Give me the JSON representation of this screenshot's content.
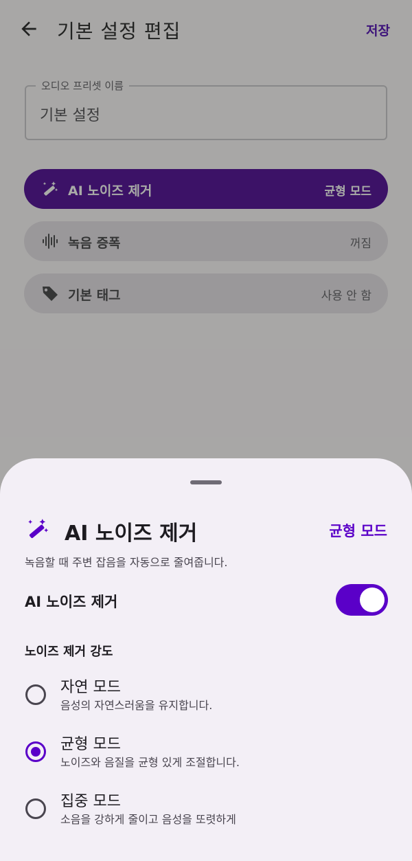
{
  "appbar": {
    "title": "기본 설정 편집",
    "save_label": "저장"
  },
  "preset_field": {
    "label": "오디오 프리셋 이름",
    "value": "기본 설정"
  },
  "settings": [
    {
      "title": "AI 노이즈 제거",
      "value": "균형 모드",
      "icon": "magic-wand-icon"
    },
    {
      "title": "녹음 증폭",
      "value": "꺼짐",
      "icon": "waveform-icon"
    },
    {
      "title": "기본 태그",
      "value": "사용 안 함",
      "icon": "tag-icon"
    }
  ],
  "sheet": {
    "title": "AI 노이즈 제거",
    "current_mode": "균형 모드",
    "description": "녹음할 때 주변 잡음을 자동으로 줄여줍니다.",
    "toggle_label": "AI 노이즈 제거",
    "toggle_on": true,
    "section_title": "노이즈 제거 강도",
    "options": [
      {
        "title": "자연 모드",
        "subtitle": "음성의 자연스러움을 유지합니다.",
        "selected": false
      },
      {
        "title": "균형 모드",
        "subtitle": "노이즈와 음질을 균형 있게 조절합니다.",
        "selected": true
      },
      {
        "title": "집중 모드",
        "subtitle": "소음을 강하게 줄이고 음성을 또렷하게",
        "selected": false
      }
    ]
  },
  "colors": {
    "accent": "#5a00c8",
    "row_active": "#4a0095",
    "scrim": "#282c24"
  }
}
